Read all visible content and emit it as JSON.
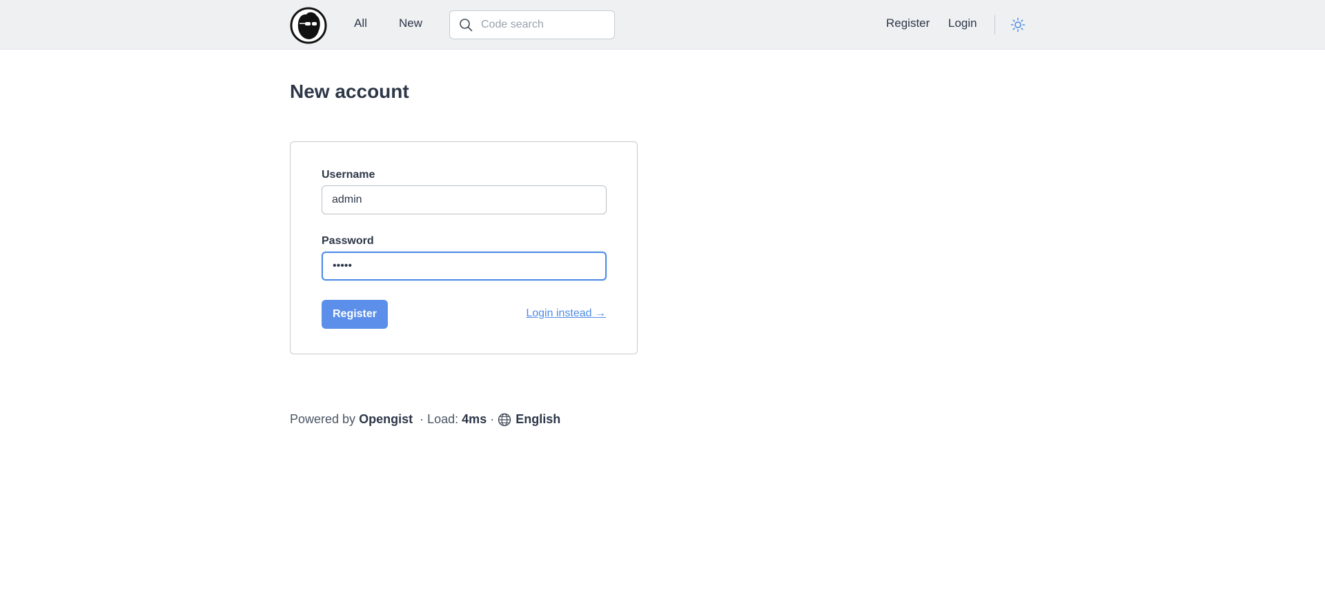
{
  "header": {
    "nav": {
      "all_label": "All",
      "new_label": "New"
    },
    "search": {
      "placeholder": "Code search",
      "value": ""
    },
    "register_label": "Register",
    "login_label": "Login"
  },
  "main": {
    "title": "New account",
    "form": {
      "username_label": "Username",
      "username_value": "admin",
      "password_label": "Password",
      "password_value": "•••••",
      "submit_label": "Register",
      "login_instead_label": "Login instead →"
    }
  },
  "footer": {
    "powered_prefix": "Powered by",
    "powered_name": "Opengist",
    "load_prefix": "· Load:",
    "load_value": "4ms",
    "separator": "·",
    "language": "English"
  },
  "colors": {
    "accent": "#5b8fe9",
    "header_bg": "#eef0f2",
    "text": "#2d3748"
  }
}
